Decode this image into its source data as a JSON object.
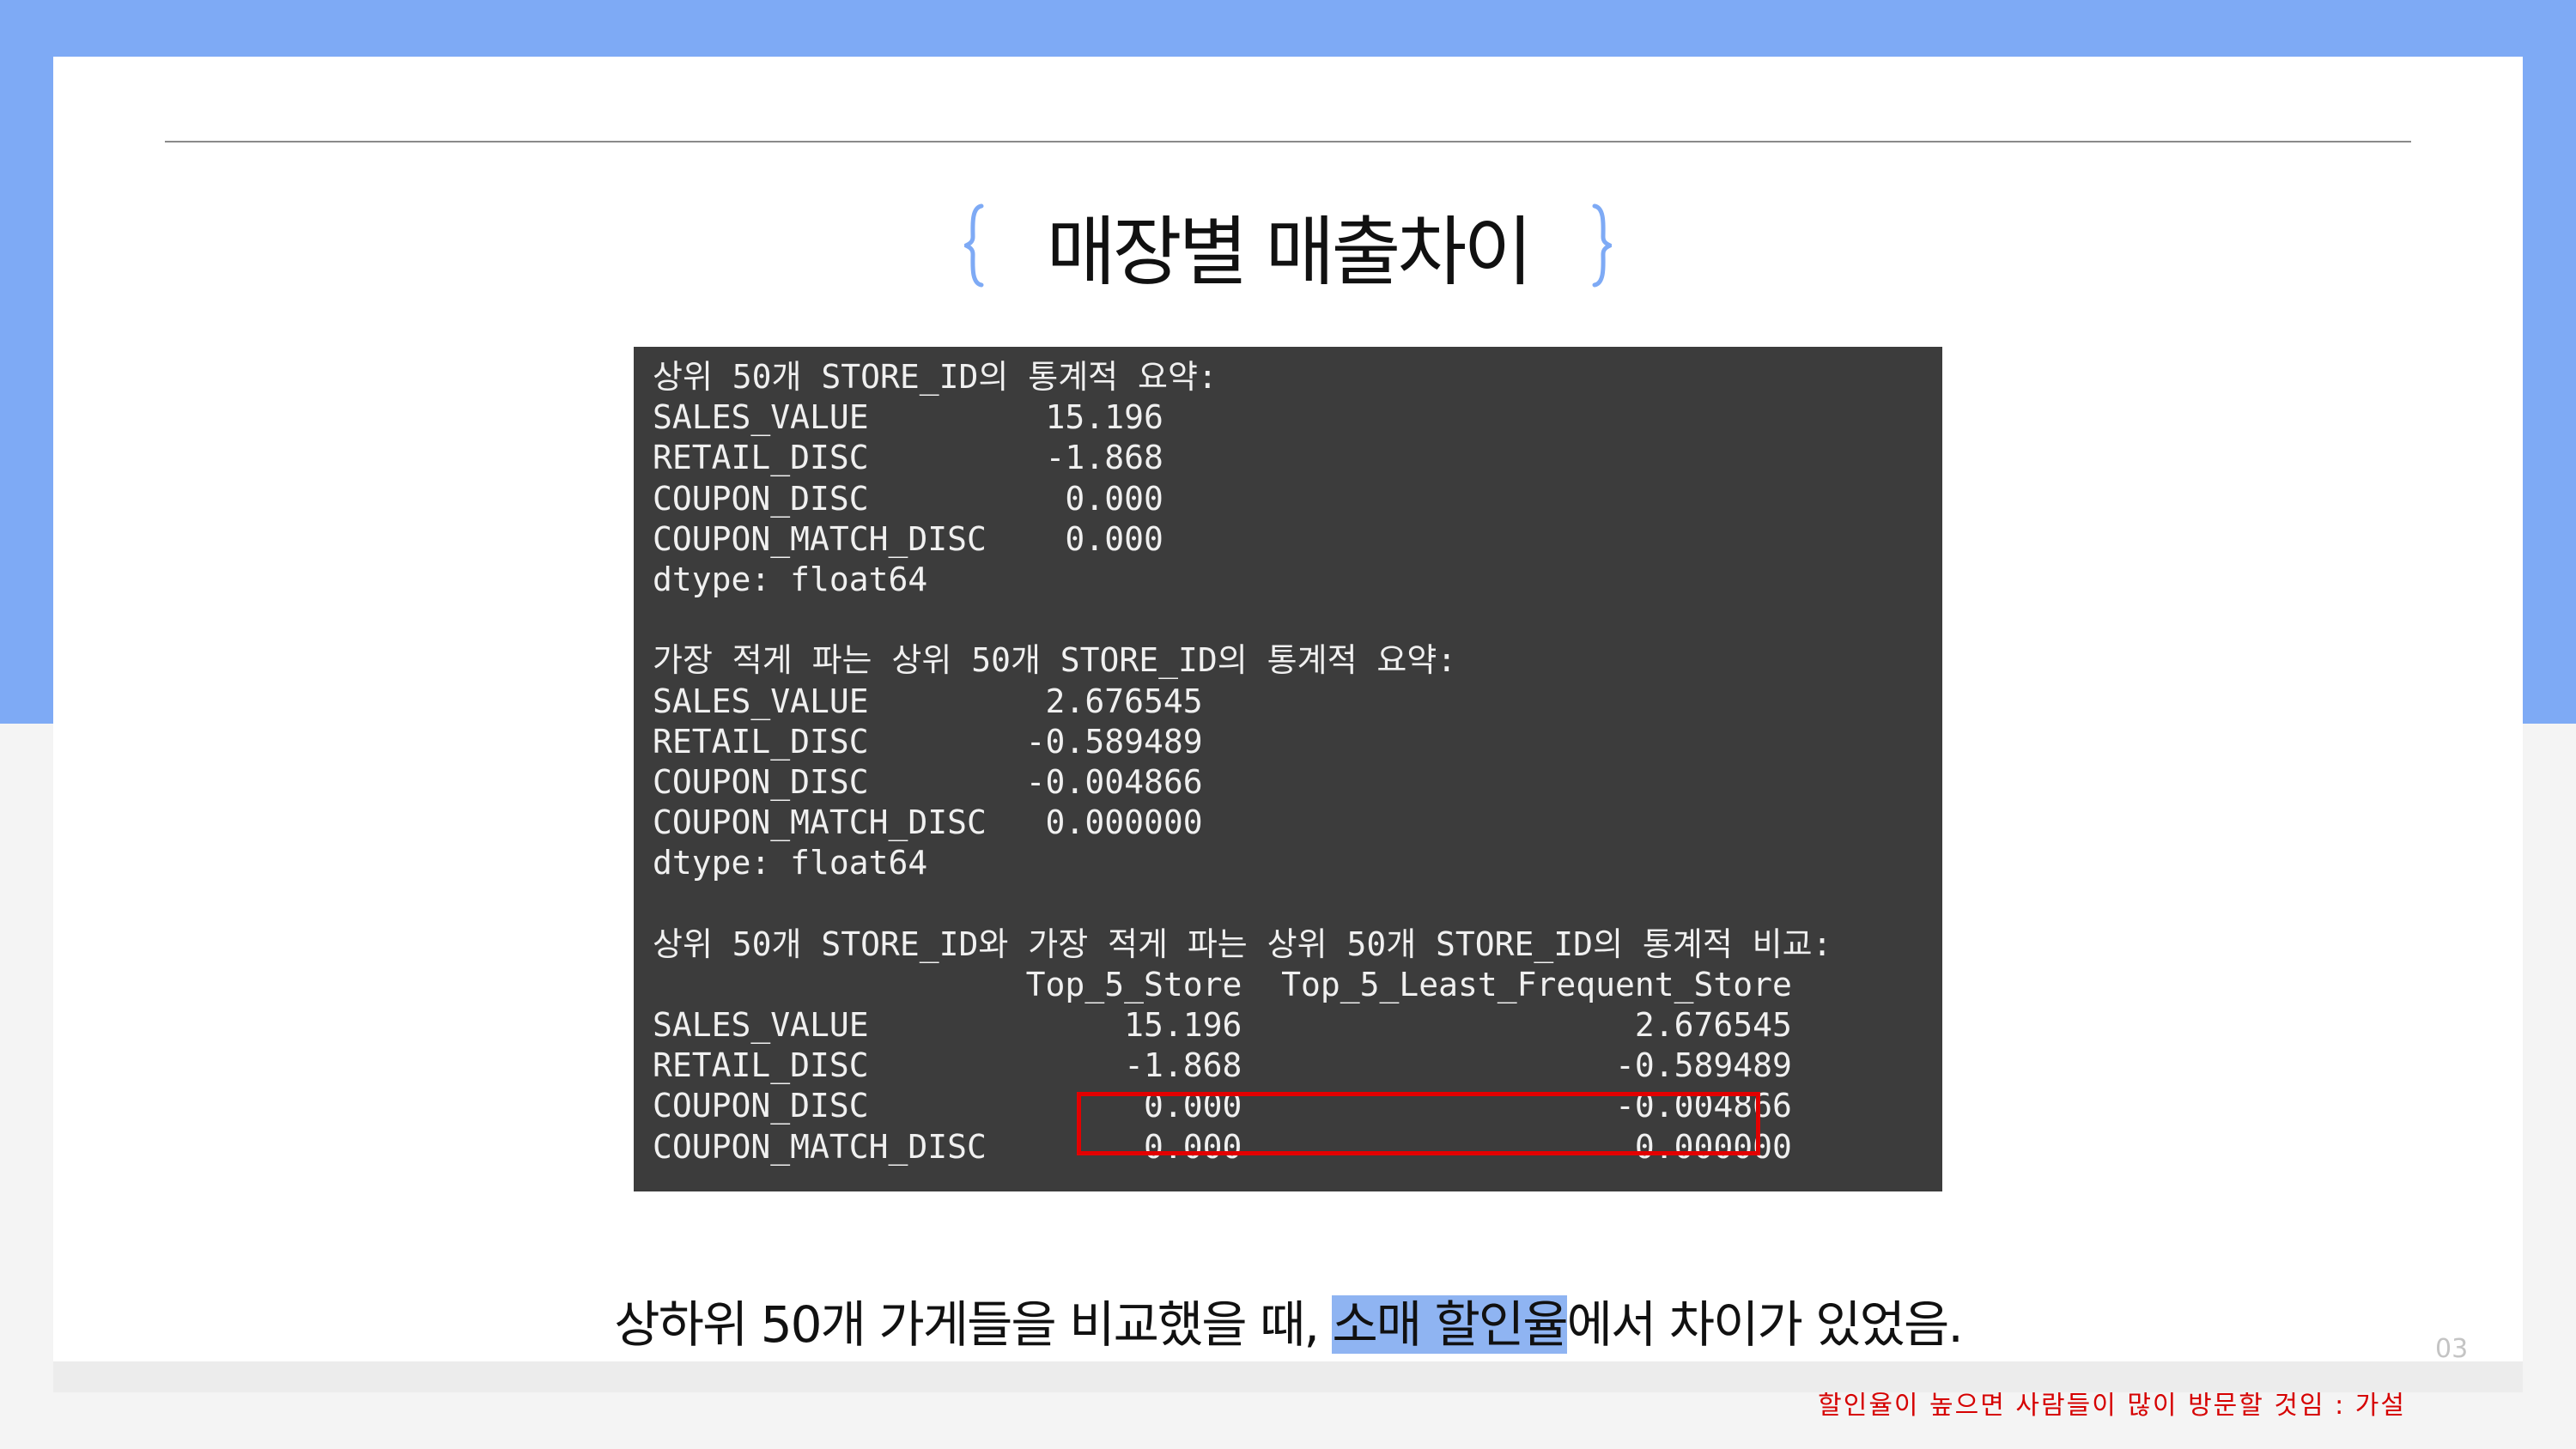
{
  "slide": {
    "title": "매장별 매출차이",
    "page_number": "03",
    "caption_before": "상하위 50개 가게들을 비교했을 때, ",
    "caption_highlight": "소매 할인율",
    "caption_after": "에서 차이가 있었음.",
    "note": "할인율이 높으면 사람들이 많이 방문할 것임 : 가설"
  },
  "console": {
    "lines": [
      "상위 50개 STORE_ID의 통계적 요약:",
      "SALES_VALUE         15.196",
      "RETAIL_DISC         -1.868",
      "COUPON_DISC          0.000",
      "COUPON_MATCH_DISC    0.000",
      "dtype: float64",
      "",
      "가장 적게 파는 상위 50개 STORE_ID의 통계적 요약:",
      "SALES_VALUE         2.676545",
      "RETAIL_DISC        -0.589489",
      "COUPON_DISC        -0.004866",
      "COUPON_MATCH_DISC   0.000000",
      "dtype: float64",
      "",
      "상위 50개 STORE_ID와 가장 적게 파는 상위 50개 STORE_ID의 통계적 비교:",
      "                   Top_5_Store  Top_5_Least_Frequent_Store",
      "SALES_VALUE             15.196                    2.676545",
      "RETAIL_DISC             -1.868                   -0.589489",
      "COUPON_DISC              0.000                   -0.004866",
      "COUPON_MATCH_DISC        0.000                    0.000000"
    ]
  },
  "colors": {
    "accent_blue": "#7eaaf5",
    "highlight_blue": "#8fb4f2",
    "console_bg": "#3c3c3c",
    "box_red": "#e30000",
    "note_red": "#d60000"
  }
}
